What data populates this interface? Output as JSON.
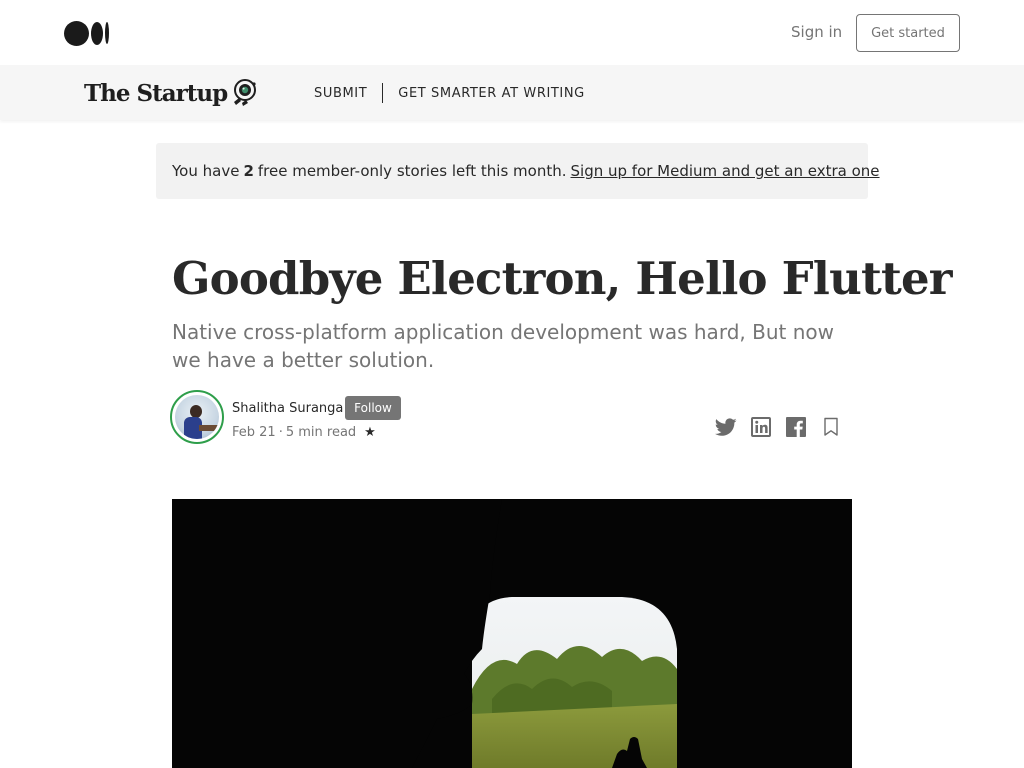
{
  "header": {
    "logo_icon": "medium-logo-icon",
    "sign_in": "Sign in",
    "get_started": "Get started"
  },
  "publication": {
    "name": "The Startup",
    "mark_icon": "camera-lens-icon",
    "nav": [
      "SUBMIT",
      "GET SMARTER AT WRITING"
    ]
  },
  "banner": {
    "text_before": "You have",
    "count": "2",
    "text_after": "free member-only stories left this month.",
    "link": "Sign up for Medium and get an extra one"
  },
  "article": {
    "title": "Goodbye Electron, Hello Flutter",
    "subtitle": "Native cross-platform application development was hard, But now we have a better solution.",
    "author": "Shalitha Suranga",
    "follow": "Follow",
    "date": "Feb 21",
    "dot": "·",
    "read_time": "5 min read",
    "star": "★",
    "share_icons": [
      "twitter-icon",
      "linkedin-icon",
      "facebook-icon",
      "bookmark-icon"
    ]
  },
  "colors": {
    "accent_ring": "#2e9e4a",
    "follow_bg": "#757575",
    "banner_bg": "#f2f2f2",
    "pubbar_bg": "#f6f6f6"
  }
}
